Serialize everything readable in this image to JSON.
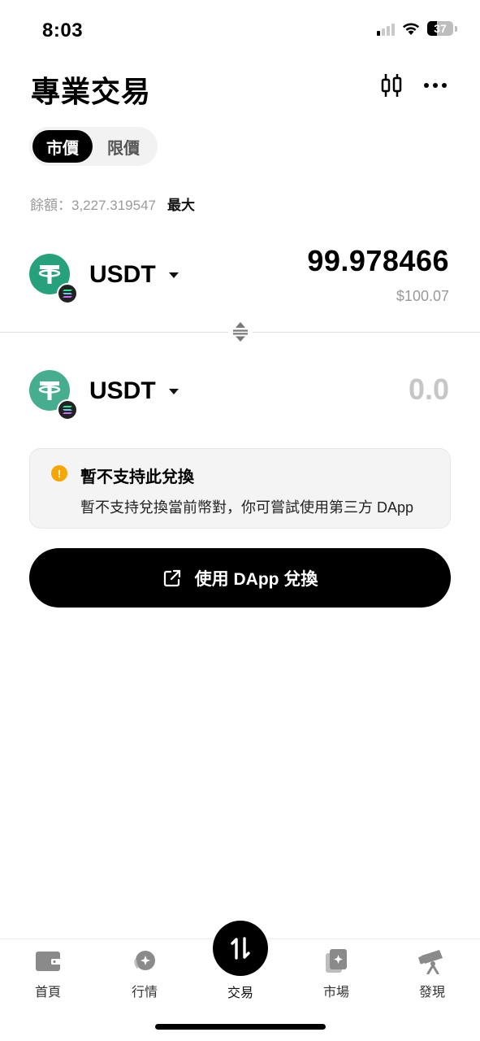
{
  "status_bar": {
    "time": "8:03",
    "battery": "37"
  },
  "header": {
    "title": "專業交易"
  },
  "order_type": {
    "market": "市價",
    "limit": "限價"
  },
  "balance": {
    "text": "餘額：3,227.319547",
    "max_label": "最大"
  },
  "from_token": {
    "symbol": "USDT",
    "amount": "99.978466",
    "usd_value": "$100.07"
  },
  "to_token": {
    "symbol": "USDT",
    "amount": "0.0"
  },
  "notice": {
    "title": "暫不支持此兌換",
    "description": "暫不支持兌換當前幣對，你可嘗試使用第三方 DApp"
  },
  "action_button": {
    "label": "使用 DApp 兌換"
  },
  "bottom_nav": {
    "items": [
      {
        "label": "首頁",
        "icon": "wallet-icon"
      },
      {
        "label": "行情",
        "icon": "market-icon"
      },
      {
        "label": "交易",
        "icon": "swap-icon"
      },
      {
        "label": "市場",
        "icon": "nft-icon"
      },
      {
        "label": "發現",
        "icon": "telescope-icon"
      }
    ]
  },
  "colors": {
    "accent": "#000000",
    "tether": "#26a17b",
    "warning": "#f7a600"
  }
}
